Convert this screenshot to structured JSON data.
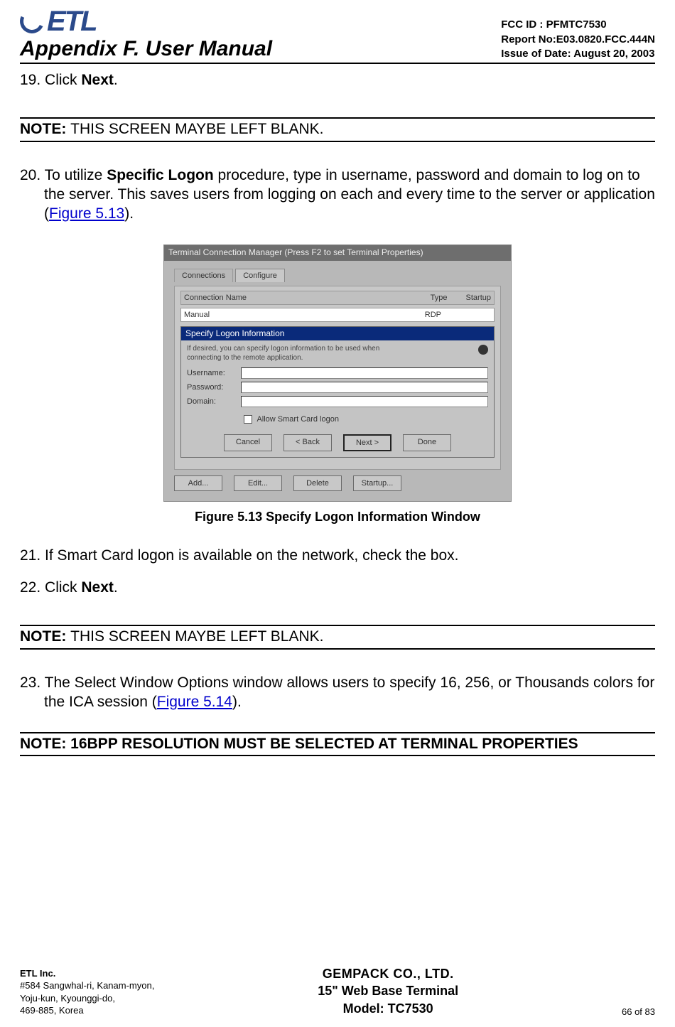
{
  "header": {
    "logo_text": "ETL",
    "title": "Appendix F. User Manual",
    "fcc_id": "FCC ID : PFMTC7530",
    "report_no": "Report No:E03.0820.FCC.444N",
    "issue_date": "Issue of Date: August 20, 2003"
  },
  "steps": {
    "s19_prefix": "19. Click ",
    "s19_bold": "Next",
    "s19_suffix": ".",
    "note1_label": "NOTE: ",
    "note1_text": "THIS SCREEN MAYBE LEFT BLANK.",
    "s20_prefix": "20. To utilize ",
    "s20_bold": "Specific Logon",
    "s20_mid": " procedure, type in username, password and domain to log on to the server.  This saves users from logging on each and every time to the server or application (",
    "s20_link": "Figure 5.13",
    "s20_suffix": ").",
    "fig_caption": "Figure 5.13    Specify Logon Information Window",
    "s21": "21. If Smart Card logon is available on the network, check the box.",
    "s22_prefix": "22. Click ",
    "s22_bold": "Next",
    "s22_suffix": ".",
    "note2_label": "NOTE: ",
    "note2_text": "THIS SCREEN MAYBE LEFT BLANK.",
    "s23_prefix": "23. The Select Window Options window allows users to specify 16, 256, or Thousands colors for the ICA session (",
    "s23_link": "Figure 5.14",
    "s23_suffix": ").",
    "note3": "NOTE: 16BPP RESOLUTION MUST BE SELECTED AT TERMINAL PROPERTIES"
  },
  "figure": {
    "titlebar": "Terminal Connection Manager  (Press F2 to set Terminal Properties)",
    "tab1": "Connections",
    "tab2": "Configure",
    "col_name": "Connection Name",
    "col_type": "Type",
    "col_startup": "Startup",
    "row_name": "Manual",
    "row_type": "RDP",
    "dlg_title": "Specify Logon Information",
    "dlg_desc": "If desired, you can specify logon information to be used when connecting to the remote application.",
    "lbl_user": "Username:",
    "lbl_pass": "Password:",
    "lbl_domain": "Domain:",
    "chk_label": "Allow Smart Card logon",
    "btn_cancel": "Cancel",
    "btn_back": "< Back",
    "btn_next": "Next >",
    "btn_done": "Done",
    "btn_add": "Add...",
    "btn_edit": "Edit...",
    "btn_delete": "Delete",
    "btn_startup": "Startup..."
  },
  "footer": {
    "left_line1_bold": "ETL Inc.",
    "left_line2": "#584 Sangwhal-ri, Kanam-myon,",
    "left_line3": "Yoju-kun, Kyounggi-do,",
    "left_line4": "469-885, Korea",
    "center_line1": "GEMPACK CO., LTD.",
    "center_line2": "15\" Web Base Terminal",
    "center_line3": "Model: TC7530",
    "page": "66 of 83"
  }
}
